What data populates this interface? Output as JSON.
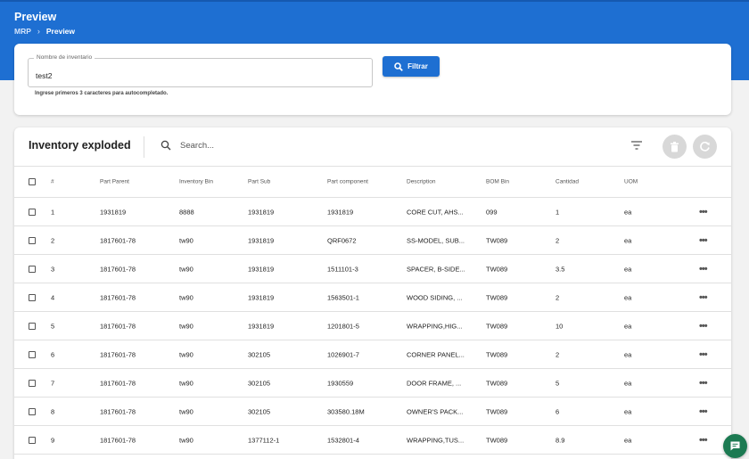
{
  "header": {
    "title": "Preview",
    "breadcrumb": [
      "MRP",
      "Preview"
    ]
  },
  "filter": {
    "field_label": "Nombre de inventario",
    "field_value": "test2",
    "button_label": "Filtrar",
    "hint": "Ingrese primeros 3 caracteres para autocompletado."
  },
  "table": {
    "title": "Inventory exploded",
    "search_placeholder": "Search...",
    "columns": [
      "#",
      "Part Parent",
      "Inventory Bin",
      "Part Sub",
      "Part component",
      "Description",
      "BOM Bin",
      "Cantidad",
      "UOM"
    ],
    "rows": [
      [
        "1",
        "1931819",
        "8888",
        "1931819",
        "1931819",
        "CORE CUT, AHS...",
        "099",
        "1",
        "ea"
      ],
      [
        "2",
        "1817601-78",
        "tw90",
        "1931819",
        "QRF0672",
        "SS-MODEL, SUB...",
        "TW089",
        "2",
        "ea"
      ],
      [
        "3",
        "1817601-78",
        "tw90",
        "1931819",
        "1511101-3",
        "SPACER, B-SIDE...",
        "TW089",
        "3.5",
        "ea"
      ],
      [
        "4",
        "1817601-78",
        "tw90",
        "1931819",
        "1563501-1",
        "WOOD SIDING, ...",
        "TW089",
        "2",
        "ea"
      ],
      [
        "5",
        "1817601-78",
        "tw90",
        "1931819",
        "1201801-5",
        "WRAPPING,HIG...",
        "TW089",
        "10",
        "ea"
      ],
      [
        "6",
        "1817601-78",
        "tw90",
        "302105",
        "1026901-7",
        "CORNER PANEL...",
        "TW089",
        "2",
        "ea"
      ],
      [
        "7",
        "1817601-78",
        "tw90",
        "302105",
        "1930559",
        "DOOR FRAME, ...",
        "TW089",
        "5",
        "ea"
      ],
      [
        "8",
        "1817601-78",
        "tw90",
        "302105",
        "303580.18M",
        "OWNER'S PACK...",
        "TW089",
        "6",
        "ea"
      ],
      [
        "9",
        "1817601-78",
        "tw90",
        "1377112-1",
        "1532801-4",
        "WRAPPING,TUS...",
        "TW089",
        "8.9",
        "ea"
      ]
    ],
    "row_action": "•••"
  },
  "colors": {
    "primary": "#1e6fd2",
    "chat_fab": "#1c7a52"
  },
  "icons": [
    "search-icon",
    "filter-lines-icon",
    "trash-icon",
    "refresh-icon",
    "more-horizontal-icon",
    "chat-icon",
    "chevron-right-icon"
  ]
}
